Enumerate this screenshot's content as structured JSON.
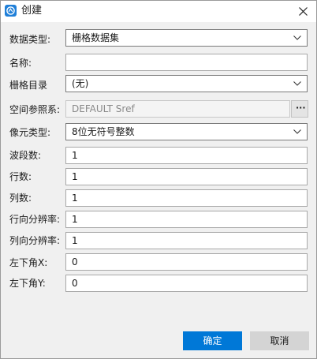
{
  "window": {
    "title": "创建",
    "app_icon": "app-logo-icon",
    "close_icon": "close-icon"
  },
  "form": {
    "data_type": {
      "label": "数据类型:",
      "value": "栅格数据集"
    },
    "name": {
      "label": "名称:",
      "value": ""
    },
    "raster_catalog": {
      "label": "栅格目录",
      "value": "(无)"
    },
    "spatial_reference": {
      "label": "空间参照系:",
      "value": "DEFAULT Sref",
      "browse_label": "···"
    },
    "pixel_type": {
      "label": "像元类型:",
      "value": "8位无符号整数"
    },
    "band_count": {
      "label": "波段数:",
      "value": "1"
    },
    "rows": {
      "label": "行数:",
      "value": "1"
    },
    "columns": {
      "label": "列数:",
      "value": "1"
    },
    "row_resolution": {
      "label": "行向分辨率:",
      "value": "1"
    },
    "column_resolution": {
      "label": "列向分辨率:",
      "value": "1"
    },
    "lower_left_x": {
      "label": "左下角X:",
      "value": "0"
    },
    "lower_left_y": {
      "label": "左下角Y:",
      "value": "0"
    }
  },
  "buttons": {
    "ok": "确定",
    "cancel": "取消"
  },
  "colors": {
    "accent": "#0078d7",
    "dialog_background": "#f0f0f0",
    "cancel_button": "#d4d4d4"
  }
}
